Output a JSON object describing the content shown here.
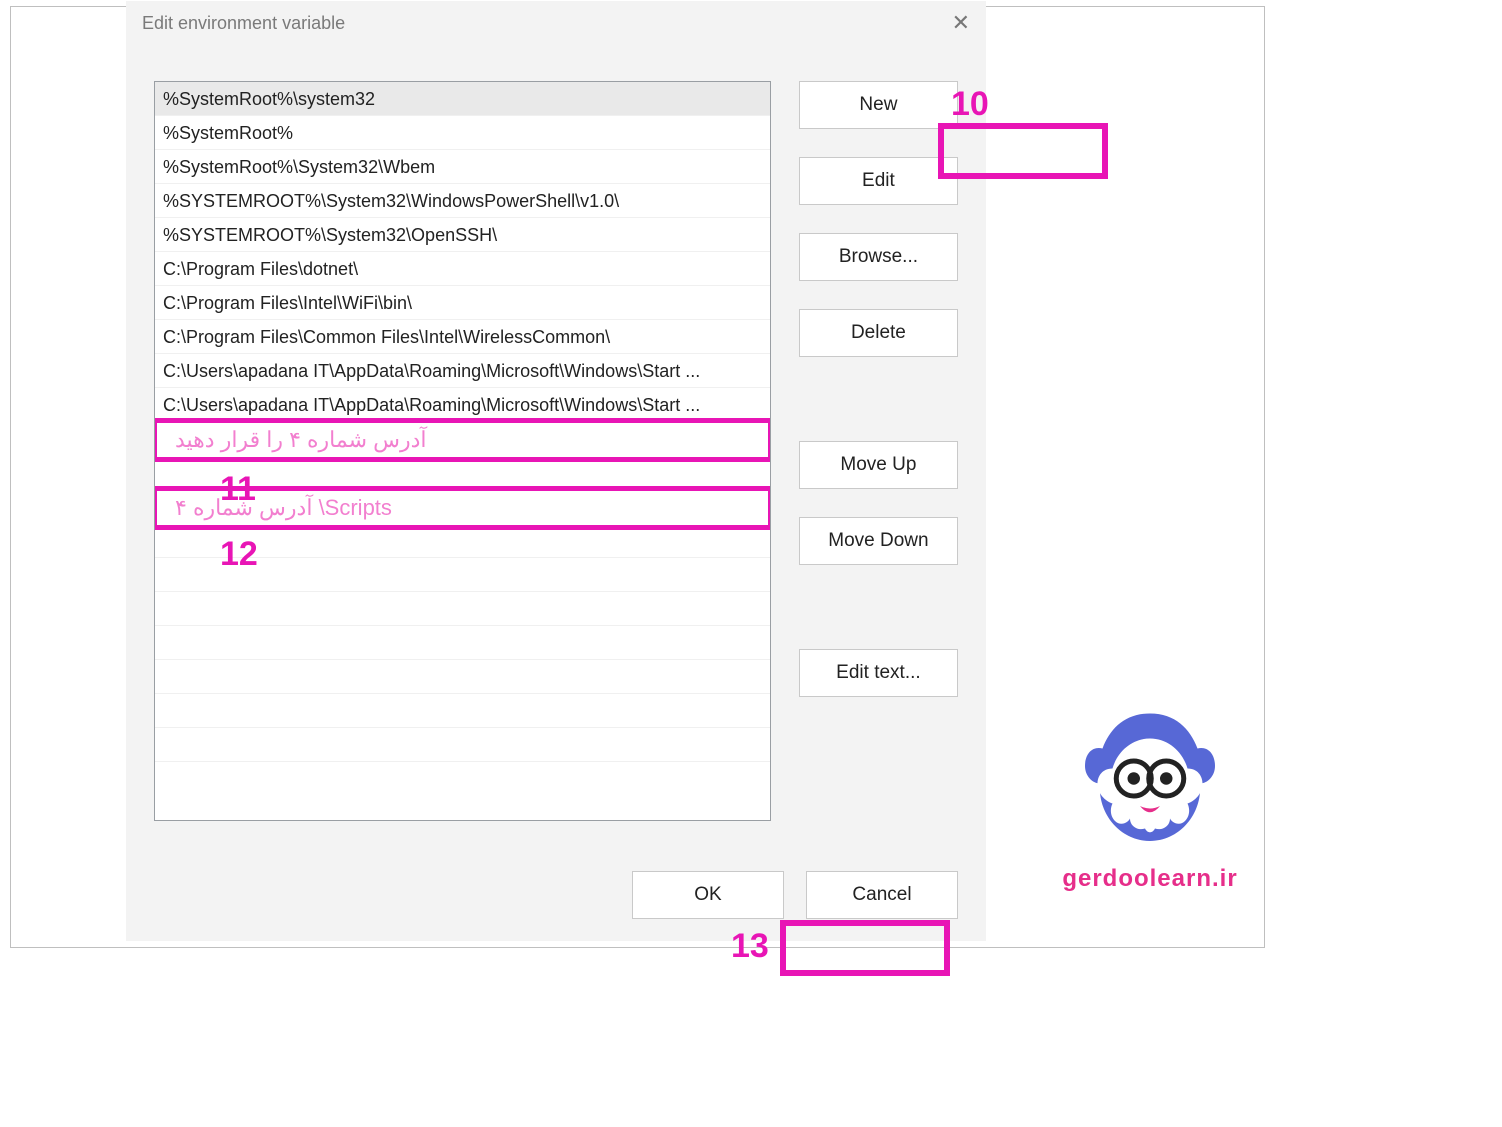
{
  "dialog": {
    "title": "Edit environment variable",
    "items": [
      "%SystemRoot%\\system32",
      "%SystemRoot%",
      "%SystemRoot%\\System32\\Wbem",
      "%SYSTEMROOT%\\System32\\WindowsPowerShell\\v1.0\\",
      "%SYSTEMROOT%\\System32\\OpenSSH\\",
      "C:\\Program Files\\dotnet\\",
      "C:\\Program Files\\Intel\\WiFi\\bin\\",
      "C:\\Program Files\\Common Files\\Intel\\WirelessCommon\\",
      "C:\\Users\\apadana IT\\AppData\\Roaming\\Microsoft\\Windows\\Start ...",
      "C:\\Users\\apadana IT\\AppData\\Roaming\\Microsoft\\Windows\\Start ..."
    ],
    "selected_index": 0,
    "annot_11_text": "آدرس شماره ۴ را قرار دهید",
    "annot_12_text": "آدرس شماره ۴ \\Scripts",
    "buttons": {
      "new": "New",
      "edit": "Edit",
      "browse": "Browse...",
      "delete": "Delete",
      "move_up": "Move Up",
      "move_down": "Move Down",
      "edit_text": "Edit text...",
      "ok": "OK",
      "cancel": "Cancel"
    }
  },
  "steps": {
    "s10": "10",
    "s11": "11",
    "s12": "12",
    "s13": "13"
  },
  "branding": {
    "text": "gerdoolearn.ir"
  }
}
